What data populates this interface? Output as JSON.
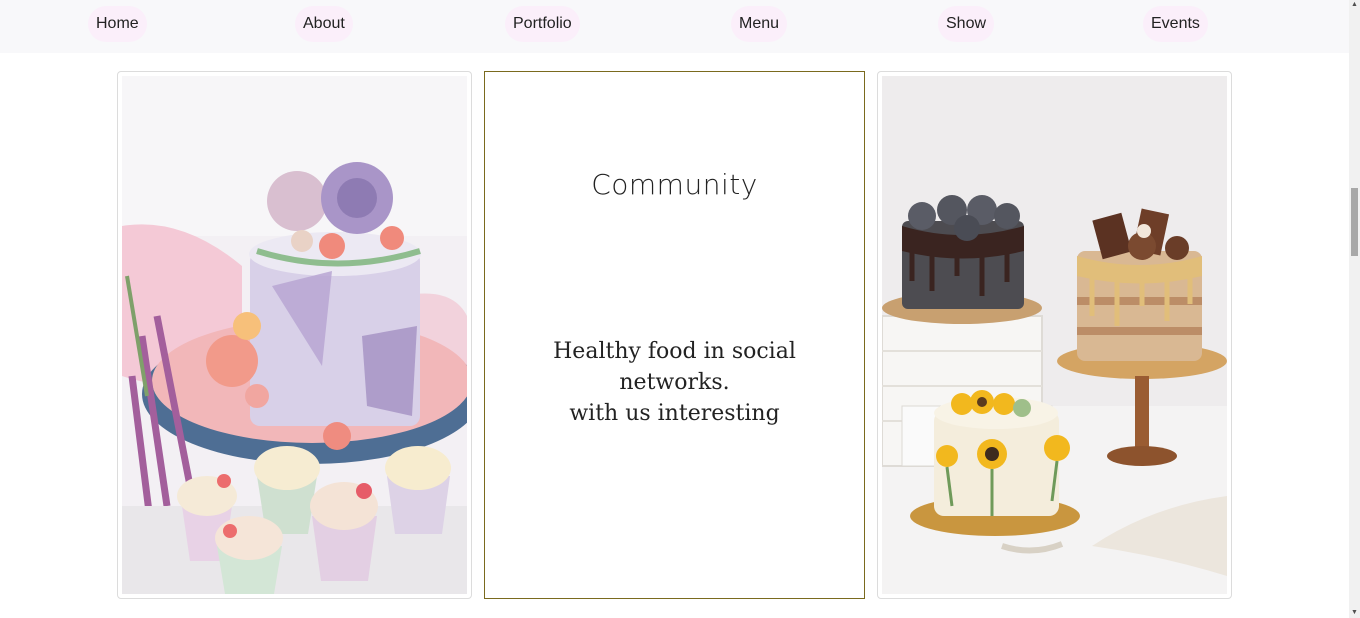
{
  "nav": {
    "items": [
      {
        "label": "Home"
      },
      {
        "label": "About"
      },
      {
        "label": "Portfolio"
      },
      {
        "label": "Menu"
      },
      {
        "label": "Show"
      },
      {
        "label": "Events"
      }
    ]
  },
  "cards": {
    "left_image": {
      "icon": "flower-cake-cupcakes-photo"
    },
    "text_card": {
      "title": "Community",
      "body_line1": "Healthy food in social networks.",
      "body_line2": "with us interesting"
    },
    "right_image": {
      "icon": "three-cakes-photo"
    }
  },
  "colors": {
    "nav_background": "#f8f8fa",
    "nav_pill": "#fbeffa",
    "text_card_border": "#7a6a1e"
  }
}
